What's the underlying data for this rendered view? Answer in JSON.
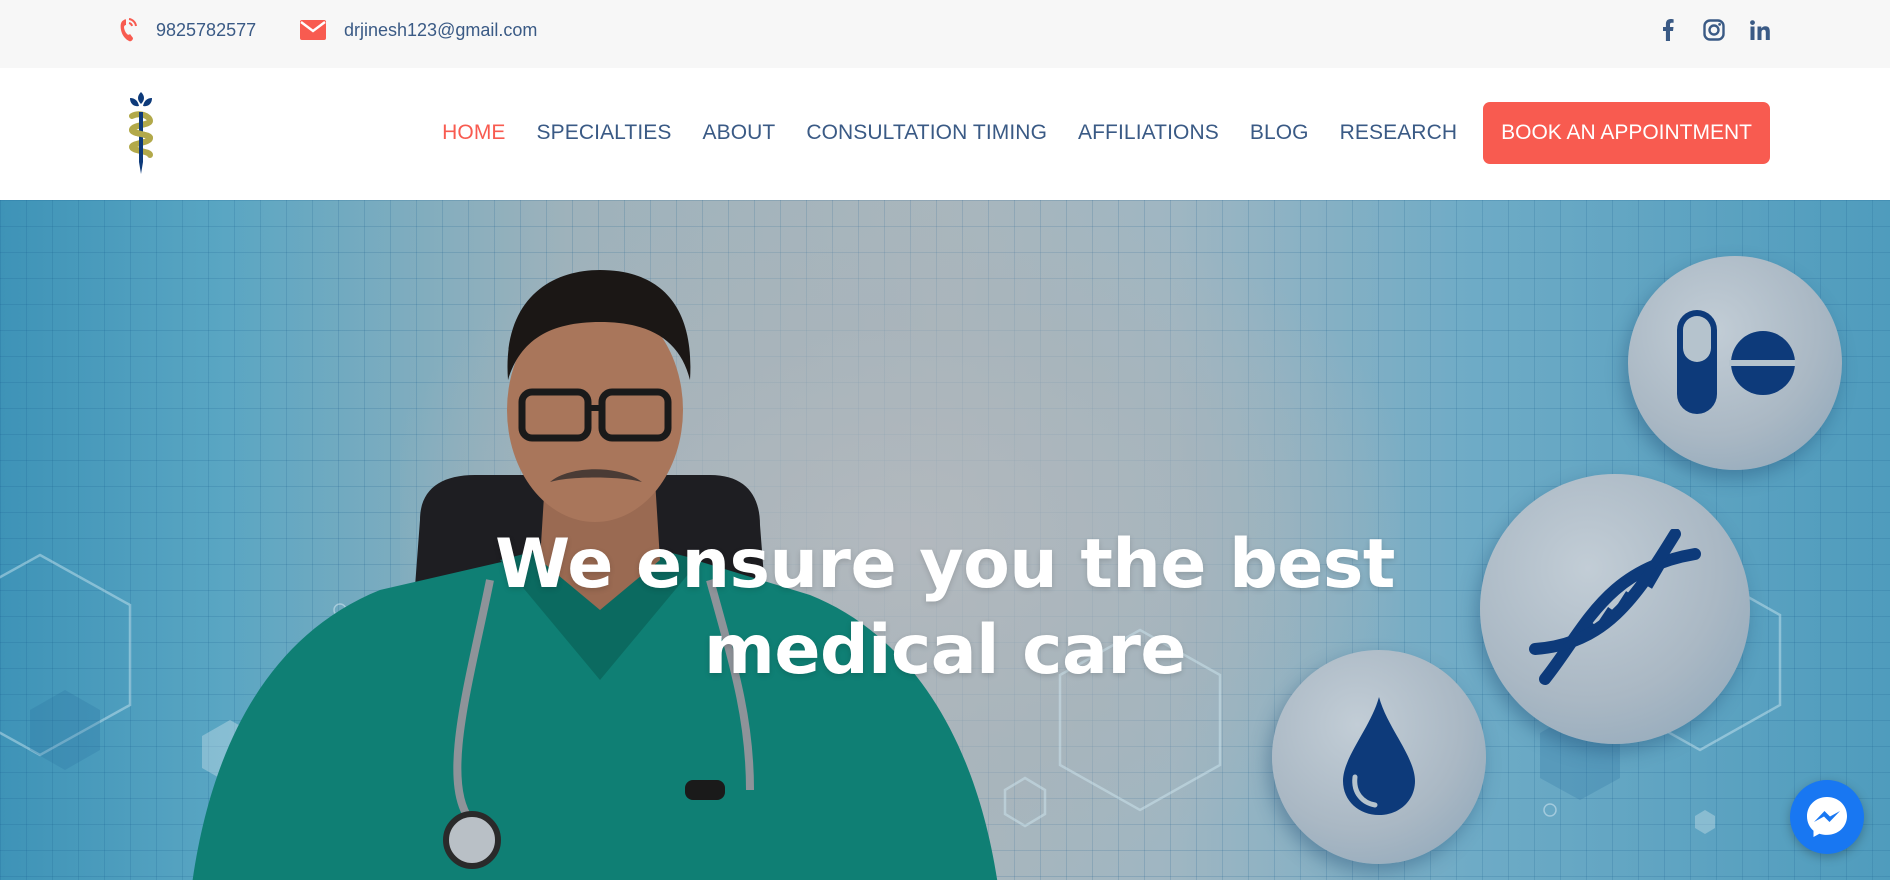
{
  "topbar": {
    "phone": "9825782577",
    "email": "drjinesh123@gmail.com",
    "social": [
      "facebook-icon",
      "instagram-icon",
      "linkedin-icon"
    ]
  },
  "nav": {
    "items": [
      {
        "label": "HOME",
        "active": true
      },
      {
        "label": "SPECIALTIES"
      },
      {
        "label": "ABOUT"
      },
      {
        "label": "CONSULTATION TIMING"
      },
      {
        "label": "AFFILIATIONS"
      },
      {
        "label": "BLOG"
      },
      {
        "label": "RESEARCH"
      }
    ],
    "cta": "BOOK AN APPOINTMENT"
  },
  "hero": {
    "title_line1": "We ensure you the best",
    "title_line2": "medical care",
    "icons": [
      "pill-icon",
      "dna-icon",
      "blood-drop-icon"
    ]
  },
  "colors": {
    "accent": "#f85b50",
    "nav_text": "#3a5a85",
    "icon_navy": "#0d3a7a",
    "messenger": "#1877f2"
  },
  "floating": {
    "icon": "messenger-icon"
  }
}
